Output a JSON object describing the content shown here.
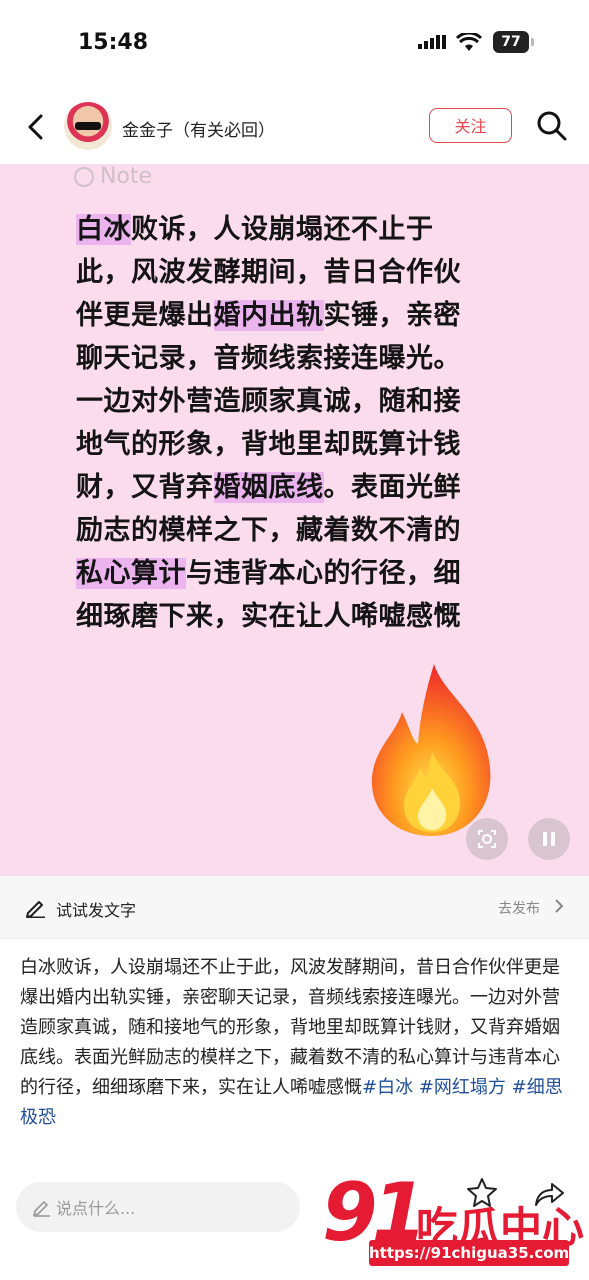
{
  "status_bar": {
    "time": "15:48",
    "battery": "77"
  },
  "header": {
    "username": "金金子（有关必回）",
    "follow_label": "关注"
  },
  "note": {
    "tag": "Note",
    "lines": [
      [
        {
          "t": "白冰",
          "hl": true
        },
        {
          "t": "败诉，人设崩塌还不止于",
          "hl": false
        }
      ],
      [
        {
          "t": "此，风波发酵期间，昔日合作伙",
          "hl": false
        }
      ],
      [
        {
          "t": "伴更是爆出",
          "hl": false
        },
        {
          "t": "婚内出轨",
          "hl": true
        },
        {
          "t": "实锤，亲密",
          "hl": false
        }
      ],
      [
        {
          "t": "聊天记录，音频线索接连曝光。",
          "hl": false
        }
      ],
      [
        {
          "t": "一边对外营造顾家真诚，随和接",
          "hl": false
        }
      ],
      [
        {
          "t": "地气的形象，背地里却既算计钱",
          "hl": false
        }
      ],
      [
        {
          "t": "财，又背弃",
          "hl": false
        },
        {
          "t": "婚姻底线",
          "hl": true
        },
        {
          "t": "。表面光鲜",
          "hl": false
        }
      ],
      [
        {
          "t": "励志的模样之下，藏着数不清的",
          "hl": false
        }
      ],
      [
        {
          "t": "私心算计",
          "hl": true
        },
        {
          "t": "与违背本心的行径，细",
          "hl": false
        }
      ],
      [
        {
          "t": "细琢磨下来，实在让人唏嘘感慨",
          "hl": false
        }
      ]
    ],
    "highlight_color": "#ecb4ef",
    "background_color": "#fbdcec"
  },
  "try_bar": {
    "label": "试试发文字",
    "publish_label": "去发布"
  },
  "body": {
    "text": "白冰败诉，人设崩塌还不止于此，风波发酵期间，昔日合作伙伴更是爆出婚内出轨实锤，亲密聊天记录，音频线索接连曝光。一边对外营造顾家真诚，随和接地气的形象，背地里却既算计钱财，又背弃婚姻底线。表面光鲜励志的模样之下，藏着数不清的私心算计与违背本心的行径，细细琢磨下来，实在让人唏嘘感慨",
    "tags": [
      "#白冰",
      "#网红塌方",
      "#细思极恐"
    ],
    "tag_color": "#1f4f97"
  },
  "bottom_bar": {
    "comment_placeholder": "说点什么...",
    "watermark_digits": "91",
    "watermark_text": "吃瓜中心",
    "watermark_url": "https://91chigua35.com"
  },
  "icons": [
    "back-arrow-icon",
    "search-icon",
    "note-circle-icon",
    "flame-emoji-icon",
    "scan-icon",
    "pause-icon",
    "pencil-icon",
    "chevron-right-icon",
    "comment-pencil-icon",
    "star-icon",
    "share-icon",
    "signal-icon",
    "wifi-icon",
    "battery-icon"
  ]
}
